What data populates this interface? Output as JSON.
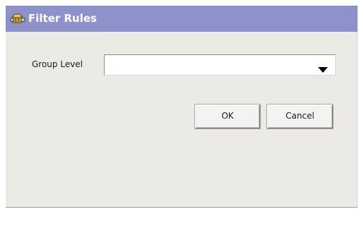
{
  "window": {
    "title": "Filter Rules",
    "title_icon": "filter-rules-icon",
    "titlebar_color": "#8d93ca",
    "background_color": "#ebeae4"
  },
  "form": {
    "group_level_label": "Group Level",
    "group_level_value": "",
    "dropdown_icon": "triangle-down-icon"
  },
  "buttons": {
    "ok_label": "OK",
    "cancel_label": "Cancel"
  }
}
